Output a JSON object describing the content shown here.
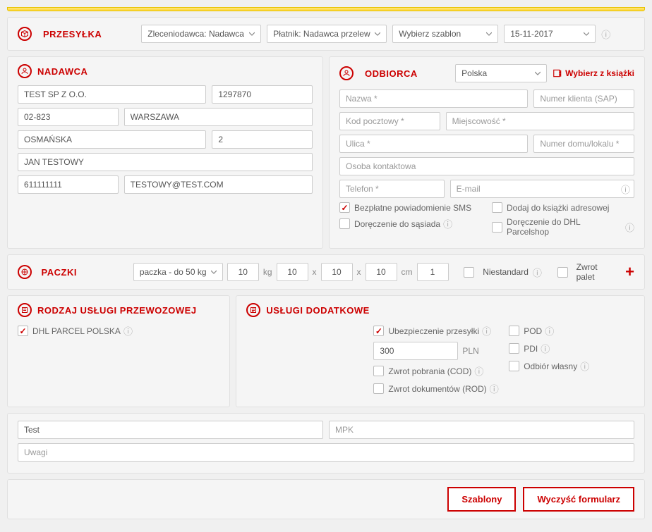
{
  "przesylka": {
    "title": "PRZESYŁKA",
    "zleceniodawca": "Zleceniodawca: Nadawca",
    "platnik": "Płatnik: Nadawca przelewem",
    "szablon": "Wybierz szablon",
    "date": "15-11-2017"
  },
  "nadawca": {
    "title": "NADAWCA",
    "name": "TEST SP Z O.O.",
    "sap": "1297870",
    "postcode": "02-823",
    "city": "WARSZAWA",
    "street": "OSMAŃSKA",
    "house": "2",
    "contact": "JAN TESTOWY",
    "phone": "611111111",
    "email": "TESTOWY@TEST.COM"
  },
  "odbiorca": {
    "title": "ODBIORCA",
    "country": "Polska",
    "book_link": "Wybierz z książki",
    "name_ph": "Nazwa *",
    "sap_ph": "Numer klienta (SAP)",
    "postcode_ph": "Kod pocztowy *",
    "city_ph": "Miejscowość *",
    "street_ph": "Ulica *",
    "house_ph": "Numer domu/lokalu *",
    "contact_ph": "Osoba kontaktowa",
    "phone_ph": "Telefon *",
    "email_ph": "E-mail",
    "sms": "Bezpłatne powiadomienie SMS",
    "neighbor": "Doręczenie do sąsiada",
    "addbook": "Dodaj do książki adresowej",
    "parcelshop": "Doręczenie do DHL Parcelshop"
  },
  "paczki": {
    "title": "PACZKI",
    "type": "paczka - do 50 kg",
    "weight": "10",
    "kg": "kg",
    "l": "10",
    "x": "x",
    "w": "10",
    "h": "10",
    "cm": "cm",
    "qty": "1",
    "nonstd": "Niestandard",
    "pallets": "Zwrot palet"
  },
  "rodzaj": {
    "title": "RODZAJ USŁUGI PRZEWOZOWEJ",
    "dhl": "DHL PARCEL POLSKA"
  },
  "uslugi": {
    "title": "USŁUGI DODATKOWE",
    "insurance": "Ubezpieczenie przesyłki",
    "insurance_val": "300",
    "pln": "PLN",
    "cod": "Zwrot pobrania (COD)",
    "rod": "Zwrot dokumentów (ROD)",
    "pod": "POD",
    "pdi": "PDI",
    "pickup": "Odbiór własny"
  },
  "bottom": {
    "ref": "Test",
    "mpk_ph": "MPK",
    "uwagi_ph": "Uwagi"
  },
  "buttons": {
    "szablony": "Szablony",
    "clear": "Wyczyść formularz"
  }
}
